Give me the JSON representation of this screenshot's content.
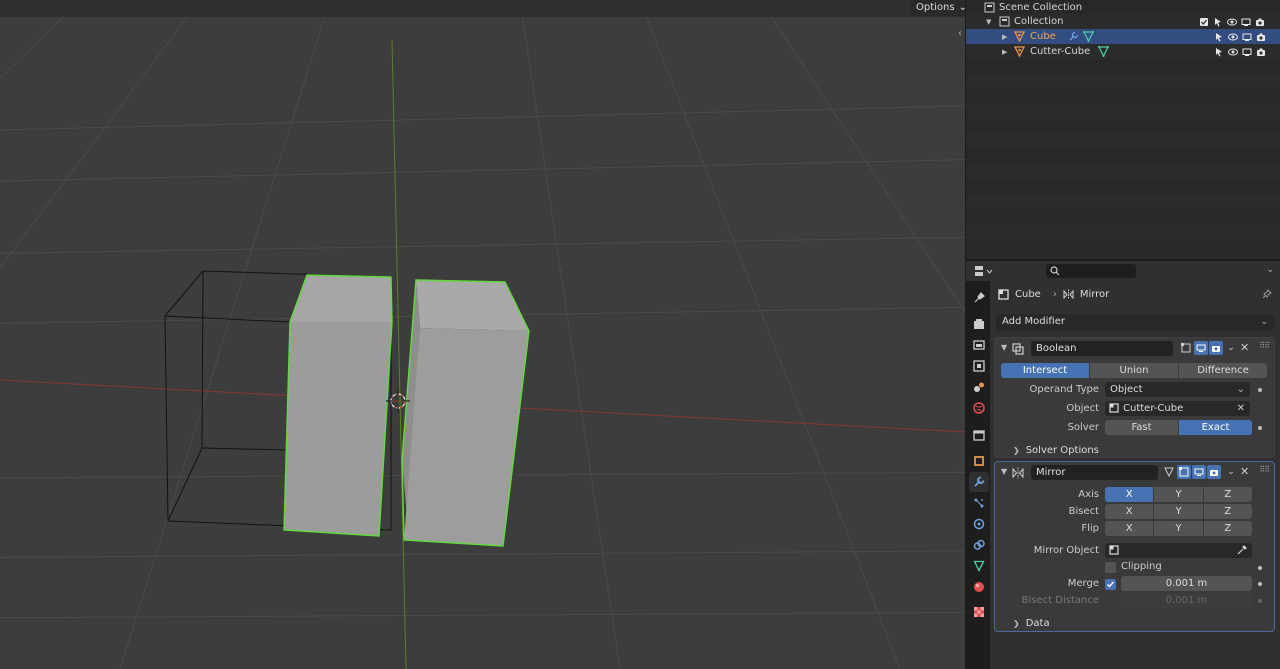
{
  "viewport": {
    "options_label": "Options",
    "options_arrow": "⌄"
  },
  "outliner": {
    "scene_collection": "Scene Collection",
    "collection": "Collection",
    "objects": [
      {
        "name": "Cube",
        "selected": true
      },
      {
        "name": "Cutter-Cube",
        "selected": false
      }
    ]
  },
  "properties": {
    "breadcrumb_object": "Cube",
    "breadcrumb_modifier": "Mirror",
    "add_modifier": "Add Modifier",
    "boolean": {
      "name": "Boolean",
      "operations": [
        "Intersect",
        "Union",
        "Difference"
      ],
      "active_operation": "Intersect",
      "operand_type_label": "Operand Type",
      "operand_type_value": "Object",
      "object_label": "Object",
      "object_value": "Cutter-Cube",
      "solver_label": "Solver",
      "solvers": [
        "Fast",
        "Exact"
      ],
      "active_solver": "Exact",
      "solver_options": "Solver Options"
    },
    "mirror": {
      "name": "Mirror",
      "axis_label": "Axis",
      "bisect_label": "Bisect",
      "flip_label": "Flip",
      "axes": [
        "X",
        "Y",
        "Z"
      ],
      "axis_active": "X",
      "mirror_object_label": "Mirror Object",
      "clipping_label": "Clipping",
      "merge_label": "Merge",
      "merge_value": "0.001 m",
      "bisect_distance_label": "Bisect Distance",
      "bisect_distance_value": "0.001 m",
      "data_label": "Data"
    }
  },
  "colors": {
    "accent": "#4772b3",
    "selection_outline": "#5fdc3c",
    "object_orange": "#e8954a",
    "mesh_green": "#4cd0a5"
  }
}
